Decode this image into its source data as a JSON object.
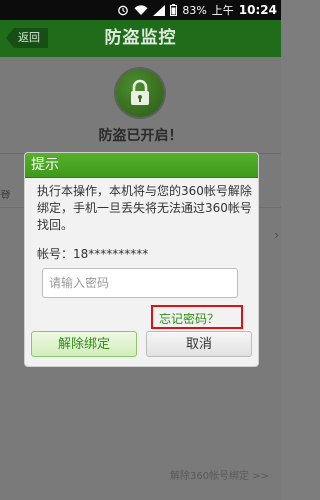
{
  "statusbar": {
    "battery": "83%",
    "ampm": "上午",
    "time": "10:24"
  },
  "header": {
    "back_label": "返回",
    "title": "防盗监控"
  },
  "main": {
    "status_text": "防盗已开启！",
    "bg_fragment": "登",
    "unbind_link": "解除360帐号绑定 >>"
  },
  "dialog": {
    "title": "提示",
    "message": "执行本操作，本机将与您的360帐号解除绑定，手机一旦丢失将无法通过360帐号找回。",
    "account": "帐号：18**********",
    "password_placeholder": "请输入密码",
    "forgot_label": "忘记密码？",
    "unbind_button": "解除绑定",
    "cancel_button": "取消"
  },
  "colors": {
    "accent": "#3f9a1c",
    "header": "#1f6d1b",
    "highlight": "#e01010"
  }
}
